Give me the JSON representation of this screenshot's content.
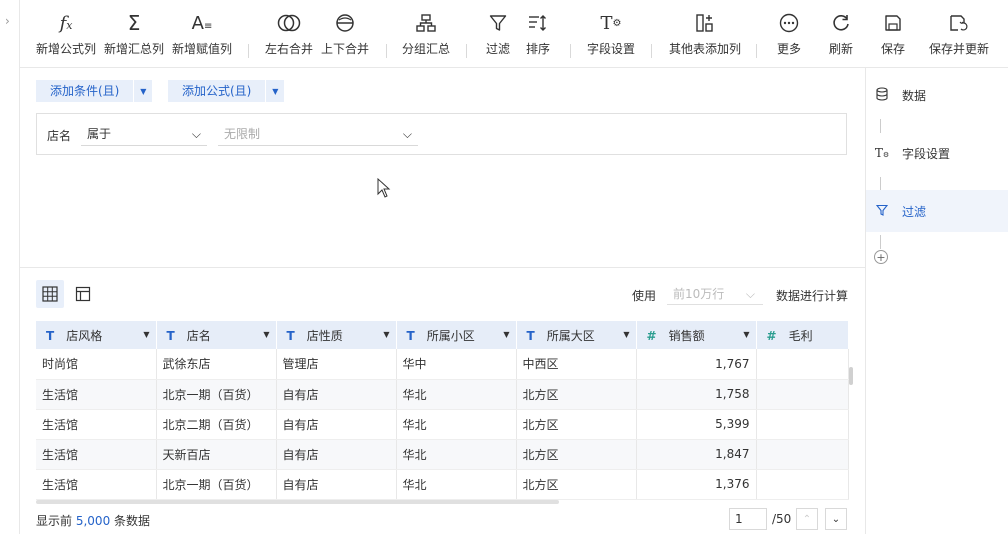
{
  "toolbar": {
    "new_formula_col": "新增公式列",
    "new_summary_col": "新增汇总列",
    "new_assign_col": "新增赋值列",
    "merge_lr": "左右合并",
    "merge_tb": "上下合并",
    "group_summary": "分组汇总",
    "filter": "过滤",
    "sort": "排序",
    "field_settings": "字段设置",
    "add_from_other_table": "其他表添加列",
    "more": "更多",
    "refresh": "刷新",
    "save": "保存",
    "save_update": "保存并更新"
  },
  "conditions": {
    "add_condition": "添加条件(且)",
    "add_formula": "添加公式(且)",
    "field_label": "店名",
    "operator": "属于",
    "value_placeholder": "无限制"
  },
  "grid": {
    "use_label": "使用",
    "rows_option": "前10万行",
    "calc_label": "数据进行计算",
    "columns": [
      {
        "type": "T",
        "name": "店风格"
      },
      {
        "type": "T",
        "name": "店名"
      },
      {
        "type": "T",
        "name": "店性质"
      },
      {
        "type": "T",
        "name": "所属小区"
      },
      {
        "type": "T",
        "name": "所属大区"
      },
      {
        "type": "#",
        "name": "销售额"
      },
      {
        "type": "#",
        "name": "毛利"
      }
    ],
    "rows": [
      [
        "时尚馆",
        "武徐东店",
        "管理店",
        "华中",
        "中西区",
        "1,767",
        ""
      ],
      [
        "生活馆",
        "北京一期（百货）",
        "自有店",
        "华北",
        "北方区",
        "1,758",
        ""
      ],
      [
        "生活馆",
        "北京二期（百货）",
        "自有店",
        "华北",
        "北方区",
        "5,399",
        ""
      ],
      [
        "生活馆",
        "天新百店",
        "自有店",
        "华北",
        "北方区",
        "1,847",
        ""
      ],
      [
        "生活馆",
        "北京一期（百货）",
        "自有店",
        "华北",
        "北方区",
        "1,376",
        ""
      ]
    ]
  },
  "footer": {
    "prefix": "显示前",
    "count": "5,000",
    "suffix": "条数据",
    "page": "1",
    "total": "/50"
  },
  "side_steps": {
    "data": "数据",
    "field_settings": "字段设置",
    "filter": "过滤"
  },
  "colors": {
    "accent": "#2563c9",
    "header_bg": "#e6edf8",
    "active_bg": "#f0f4fb"
  }
}
